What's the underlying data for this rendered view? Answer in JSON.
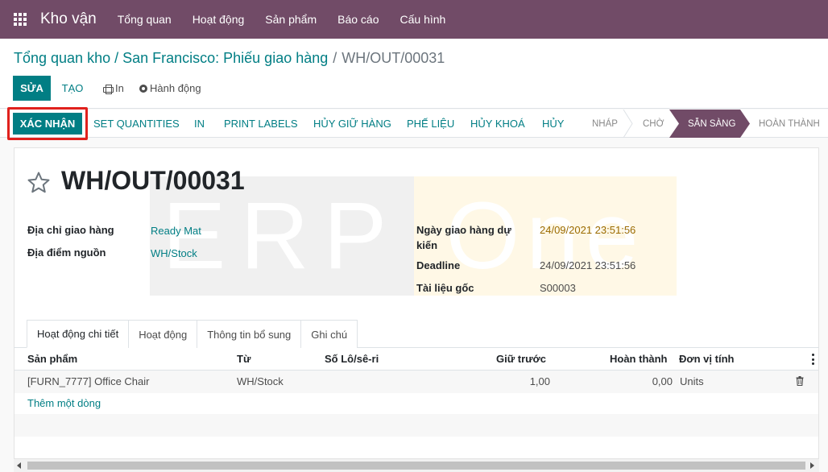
{
  "navbar": {
    "app_name": "Kho vận",
    "menu": [
      "Tổng quan",
      "Hoạt động",
      "Sản phẩm",
      "Báo cáo",
      "Cấu hình"
    ],
    "color": "#714b67"
  },
  "breadcrumb": {
    "parent": "Tổng quan kho / San Francisco: Phiếu giao hàng",
    "separator": "/",
    "current": "WH/OUT/00031"
  },
  "toolbar": {
    "edit_label": "SỬA",
    "create_label": "TẠO",
    "print_label": "In",
    "action_label": "Hành động"
  },
  "statusbar": {
    "buttons": [
      "XÁC NHẬN",
      "SET QUANTITIES",
      "IN",
      "PRINT LABELS",
      "HỦY GIỮ HÀNG",
      "PHẾ LIỆU",
      "HỦY KHOÁ",
      "HỦY"
    ],
    "stages": [
      "NHÁP",
      "CHỜ",
      "SẴN SÀNG",
      "HOÀN THÀNH"
    ],
    "current_stage": "SẴN SÀNG",
    "accent": "#017e84",
    "highlight_color": "#e0211d"
  },
  "record": {
    "name": "WH/OUT/00031",
    "fields_left": [
      {
        "label": "Địa chỉ giao hàng",
        "value": "Ready Mat"
      },
      {
        "label": "Địa điểm nguồn",
        "value": "WH/Stock"
      }
    ],
    "fields_right": [
      {
        "label": "Ngày giao hàng dự kiến",
        "label_line1": "Ngày giao hàng dự",
        "label_line2": "kiến",
        "value": "24/09/2021 23:51:56"
      },
      {
        "label": "Deadline",
        "value": "24/09/2021 23:51:56"
      },
      {
        "label": "Tài liệu gốc",
        "value": "S00003"
      }
    ]
  },
  "watermark": {
    "left": "ERP",
    "right": "One"
  },
  "tabs": [
    "Hoạt động chi tiết",
    "Hoạt động",
    "Thông tin bổ sung",
    "Ghi chú"
  ],
  "table": {
    "columns": [
      "Sản phẩm",
      "Từ",
      "Số Lô/sê-ri",
      "Giữ trước",
      "Hoàn thành",
      "Đơn vị tính"
    ],
    "rows": [
      {
        "product": "[FURN_7777] Office Chair",
        "from": "WH/Stock",
        "lot": "",
        "reserved": "1,00",
        "done": "0,00",
        "uom": "Units"
      }
    ],
    "add_line": "Thêm một dòng"
  }
}
